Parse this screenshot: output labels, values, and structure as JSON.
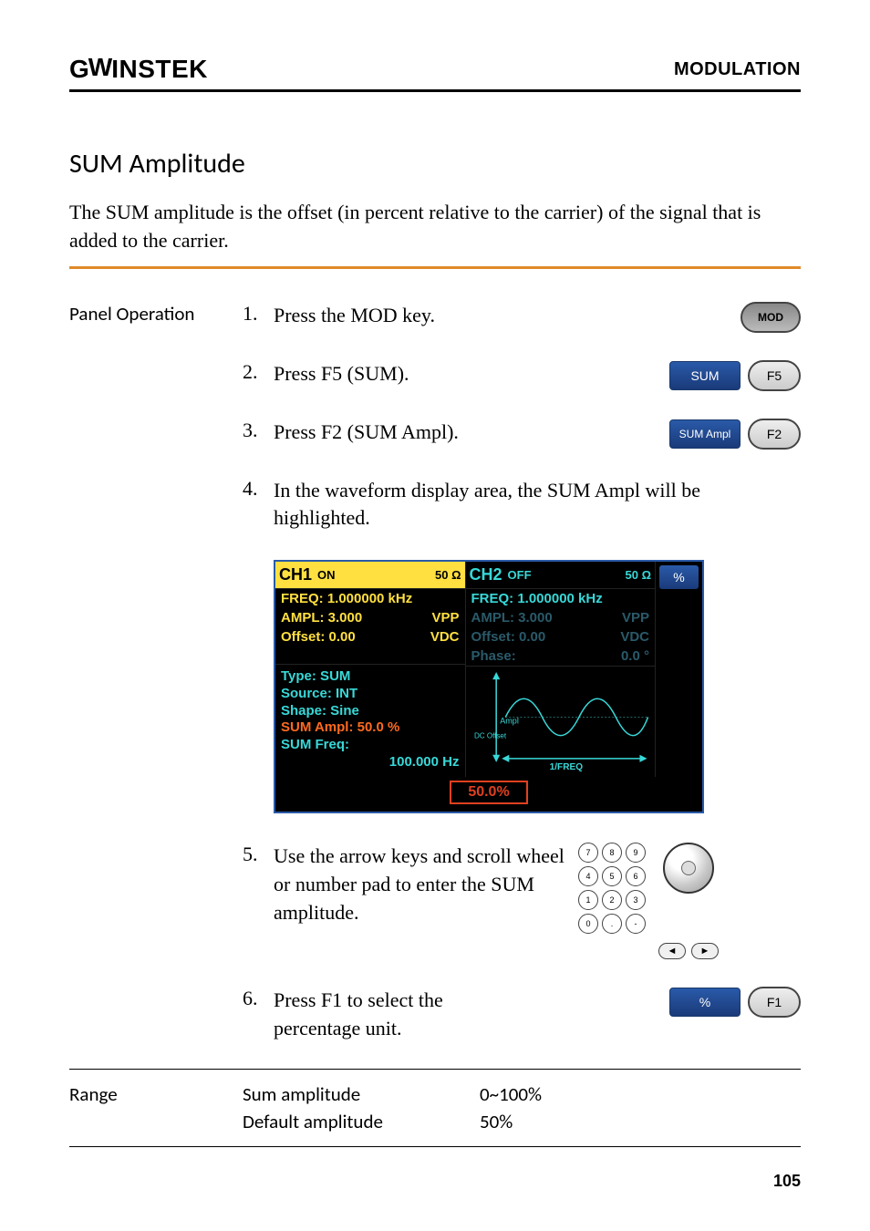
{
  "header": {
    "brand_prefix": "G",
    "brand_mid": "W",
    "brand_rest": "INSTEK",
    "section": "MODULATION"
  },
  "title": "SUM Amplitude",
  "intro": "The SUM amplitude is the offset (in percent relative to the carrier) of the signal that is added to the carrier.",
  "panel_label": "Panel Operation",
  "steps": {
    "s1": {
      "num": "1.",
      "text": "Press the MOD key.",
      "key": "MOD"
    },
    "s2": {
      "num": "2.",
      "text": "Press F5 (SUM).",
      "soft": "SUM",
      "fn": "F5"
    },
    "s3": {
      "num": "3.",
      "text": "Press F2 (SUM Ampl).",
      "soft": "SUM Ampl",
      "fn": "F2"
    },
    "s4": {
      "num": "4.",
      "text": "In the waveform display area, the SUM Ampl will be highlighted."
    },
    "s5": {
      "num": "5.",
      "text": "Use the arrow keys and scroll wheel or number pad to enter the SUM amplitude."
    },
    "s6": {
      "num": "6.",
      "text": "Press F1 to select the percentage unit.",
      "soft": "%",
      "fn": "F1"
    }
  },
  "display": {
    "ch1": {
      "name": "CH1",
      "state": "ON",
      "ohm": "50 Ω",
      "freq_l": "FREQ: 1.000000 kHz",
      "ampl_l": "AMPL:  3.000",
      "ampl_u": "VPP",
      "off_l": "Offset:  0.00",
      "off_u": "VDC"
    },
    "ch2": {
      "name": "CH2",
      "state": "OFF",
      "ohm": "50 Ω",
      "freq_l": "FREQ: 1.000000 kHz",
      "ampl_l": "AMPL:  3.000",
      "ampl_u": "VPP",
      "off_l": "Offset:  0.00",
      "off_u": "VDC",
      "phase_l": "Phase:",
      "phase_v": "0.0 °"
    },
    "mod": {
      "type": "Type: SUM",
      "source": "Source: INT",
      "shape": "Shape: Sine",
      "ampl": "SUM Ampl: 50.0 %",
      "freq_l": "SUM Freq:",
      "freq_v": "100.000  Hz"
    },
    "wave": {
      "ampl_label": "Ampl",
      "dc_label": "DC Offset",
      "freq_label": "1/FREQ"
    },
    "input_value": "50.0%",
    "side_btn": "%"
  },
  "keypad": {
    "keys": [
      "7",
      "8",
      "9",
      "4",
      "5",
      "6",
      "1",
      "2",
      "3",
      "0",
      ".",
      "-"
    ],
    "left_arrow": "◄",
    "right_arrow": "►"
  },
  "range": {
    "label": "Range",
    "r1k": "Sum amplitude",
    "r1v": "0~100%",
    "r2k": "Default amplitude",
    "r2v": "50%"
  },
  "page": "105"
}
